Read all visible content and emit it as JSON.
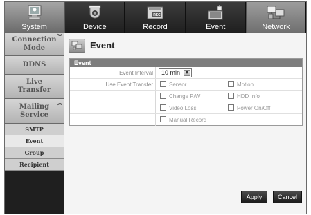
{
  "tabs": [
    {
      "label": "System",
      "icon": "system-monitor-icon"
    },
    {
      "label": "Device",
      "icon": "camera-icon"
    },
    {
      "label": "Record",
      "icon": "record-icon"
    },
    {
      "label": "Event",
      "icon": "event-icon"
    },
    {
      "label": "Network",
      "icon": "network-icon"
    }
  ],
  "sidebar": {
    "items": [
      {
        "label": "Connection Mode"
      },
      {
        "label": "DDNS"
      },
      {
        "label": "Live Transfer"
      },
      {
        "label": "Mailing Service"
      }
    ],
    "sub_items": [
      {
        "label": "SMTP"
      },
      {
        "label": "Event"
      },
      {
        "label": "Group"
      },
      {
        "label": "Recipient"
      }
    ]
  },
  "page": {
    "title": "Event"
  },
  "panel": {
    "header": "Event",
    "event_interval_label": "Event Interval",
    "event_interval_value": "10 min",
    "use_event_transfer_label": "Use Event Transfer",
    "checkboxes": [
      {
        "label": "Sensor",
        "checked": false
      },
      {
        "label": "Motion",
        "checked": false
      },
      {
        "label": "Change P/W",
        "checked": false
      },
      {
        "label": "HDD Info",
        "checked": false
      },
      {
        "label": "Video Loss",
        "checked": false
      },
      {
        "label": "Power On/Off",
        "checked": false
      },
      {
        "label": "Manual Record",
        "checked": false
      }
    ]
  },
  "buttons": {
    "apply": "Apply",
    "cancel": "Cancel"
  },
  "colors": {
    "tabbar": "#2a2a2a",
    "active_tab": "#8a8a8a",
    "sidebar_item": "#c4c4c4",
    "panel_header": "#7d7d7d"
  }
}
